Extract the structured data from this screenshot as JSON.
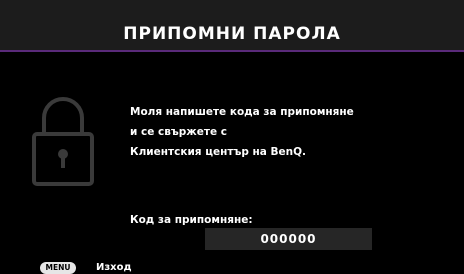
{
  "dialog": {
    "title": "ПРИПОМНИ ПАРОЛА",
    "icon": "lock-icon",
    "message_lines": [
      "Моля напишете кода за припомняне",
      "и се свържете с",
      "Клиентския център на BenQ."
    ],
    "code_label": "Код за припомняне:",
    "code_value": "000000"
  },
  "footer": {
    "menu_key": "MENU",
    "exit_label": "Изход"
  },
  "colors": {
    "header_bg": "#1c1c1c",
    "accent": "#5a2a7a",
    "field_bg": "#262626",
    "icon_stroke": "#3a3a3a"
  }
}
